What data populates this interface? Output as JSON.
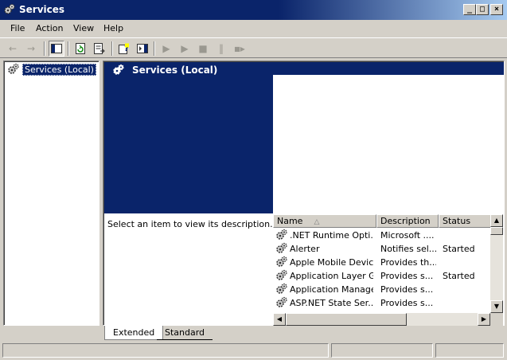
{
  "window": {
    "title": "Services",
    "minimize_glyph": "_",
    "maximize_glyph": "□",
    "close_glyph": "×"
  },
  "menu": [
    "File",
    "Action",
    "View",
    "Help"
  ],
  "toolbar": {
    "back_glyph": "←",
    "forward_glyph": "→",
    "play_glyph": "▶",
    "stop_glyph": "■",
    "pause_glyph": "‖"
  },
  "tree": {
    "root_label": "Services (Local)"
  },
  "banner": {
    "title": "Services (Local)"
  },
  "description_panel": {
    "hint": "Select an item to view its description."
  },
  "list": {
    "columns": [
      "Name",
      "Description",
      "Status"
    ],
    "sort_glyph": "△",
    "rows": [
      {
        "name": ".NET Runtime Opti...",
        "description": "Microsoft ....",
        "status": ""
      },
      {
        "name": "Alerter",
        "description": "Notifies sel...",
        "status": "Started"
      },
      {
        "name": "Apple Mobile Device",
        "description": "Provides th...",
        "status": ""
      },
      {
        "name": "Application Layer G...",
        "description": "Provides s...",
        "status": "Started"
      },
      {
        "name": "Application Manage...",
        "description": "Provides s...",
        "status": ""
      },
      {
        "name": "ASP.NET State Ser...",
        "description": "Provides s...",
        "status": ""
      }
    ]
  },
  "scroll": {
    "up_glyph": "▲",
    "down_glyph": "▼",
    "left_glyph": "◀",
    "right_glyph": "▶"
  },
  "tabs": [
    "Extended",
    "Standard"
  ],
  "colors": {
    "titlebar": "#0a246a",
    "face": "#d4d0c8",
    "selection": "#0a246a"
  }
}
